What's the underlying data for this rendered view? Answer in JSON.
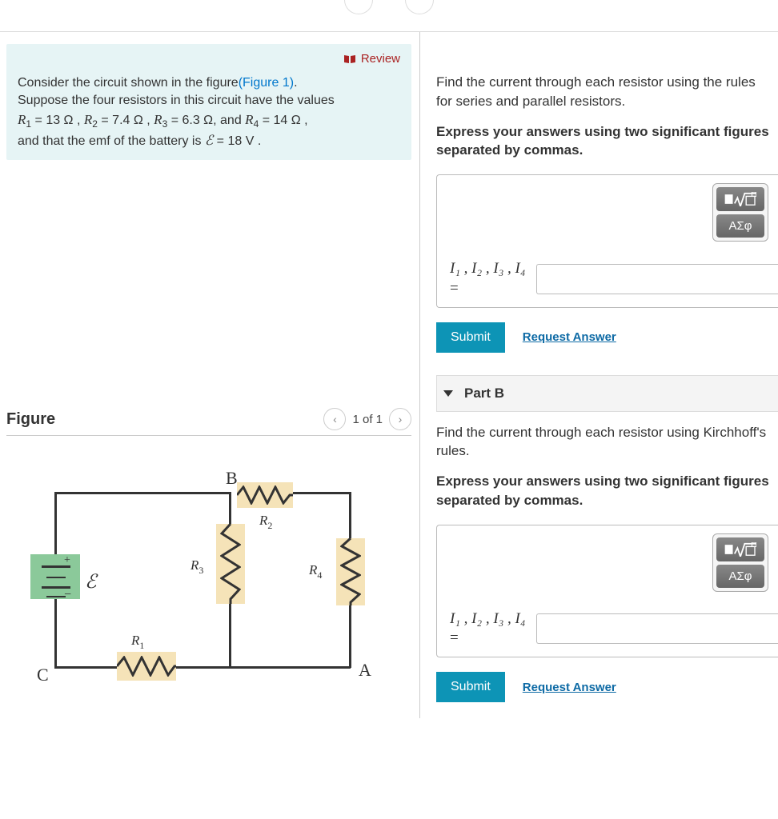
{
  "review_label": "Review",
  "problem": {
    "line1a": "Consider the circuit shown in the figure",
    "figlink": "(Figure 1)",
    "line1b": ".",
    "line2": "Suppose the four resistors in this circuit have the values",
    "R1": "R",
    "R1sub": "1",
    "R1val": " = 13 Ω",
    "R2": "R",
    "R2sub": "2",
    "R2val": " = 7.4 Ω",
    "R3": "R",
    "R3sub": "3",
    "R3val": " = 6.3 Ω",
    "R4": "R",
    "R4sub": "4",
    "R4val": " = 14 Ω",
    "sep": " , ",
    "and": ", and ",
    "line3a": "and that the emf of the battery is ",
    "emf": "ℰ",
    "emfval": " = 18 V ."
  },
  "figure": {
    "title": "Figure",
    "counter": "1 of 1",
    "labels": {
      "B": "B",
      "A": "A",
      "C": "C",
      "E": "ℰ",
      "R1": "R",
      "R1s": "1",
      "R2": "R",
      "R2s": "2",
      "R3": "R",
      "R3s": "3",
      "R4": "R",
      "R4s": "4",
      "plus": "+",
      "minus": "−"
    }
  },
  "partA": {
    "question": "Find the current through each resistor using the rules for series and parallel resistors.",
    "instruction": "Express your answers using two significant figures separated by commas.",
    "vars_line": "I₁ , I₂ , I₃ , I₄",
    "eq": "=",
    "tool_greek": "ΑΣφ",
    "submit": "Submit",
    "request": "Request Answer"
  },
  "partB": {
    "title": "Part B",
    "question": "Find the current through each resistor using Kirchhoff's rules.",
    "instruction": "Express your answers using two significant figures separated by commas.",
    "vars_line": "I₁ , I₂ , I₃ , I₄",
    "eq": "=",
    "tool_greek": "ΑΣφ",
    "submit": "Submit",
    "request": "Request Answer"
  }
}
